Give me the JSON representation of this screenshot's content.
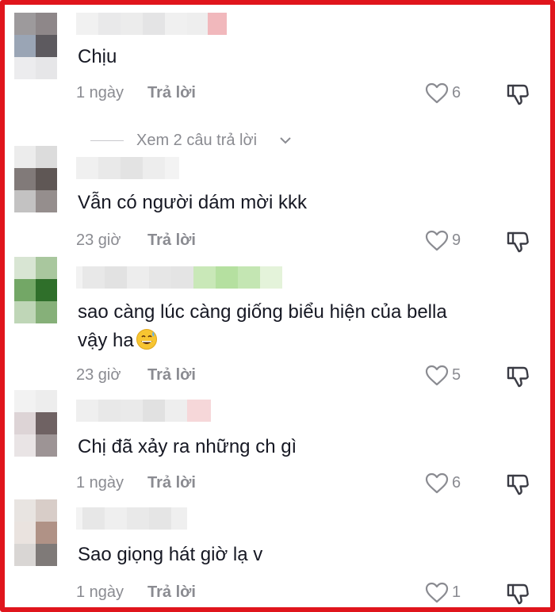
{
  "comments": [
    {
      "text": "Chịu",
      "time": "1 ngày",
      "reply": "Trả lời",
      "likes": "6"
    },
    {
      "text": "Vẫn có người dám mời kkk",
      "time": "23 giờ",
      "reply": "Trả lời",
      "likes": "9"
    },
    {
      "text_line1": "sao càng lúc càng giống biểu hiện của bella",
      "text_line2": "vậy ha",
      "time": "23 giờ",
      "reply": "Trả lời",
      "likes": "5"
    },
    {
      "text": "Chị đã xảy ra những ch gì",
      "time": "1 ngày",
      "reply": "Trả lời",
      "likes": "6"
    },
    {
      "text": "Sao giọng hát giờ lạ v",
      "time": "1 ngày",
      "reply": "Trả lời",
      "likes": "1"
    }
  ],
  "view_replies": {
    "label": "Xem 2 câu trả lời"
  },
  "colors": {
    "frame": "#e0151c",
    "meta": "#8a8b91",
    "text": "#161823"
  },
  "icons": {
    "like": "heart-outline-icon",
    "dislike": "thumbs-down-icon",
    "expand": "chevron-down-icon"
  }
}
